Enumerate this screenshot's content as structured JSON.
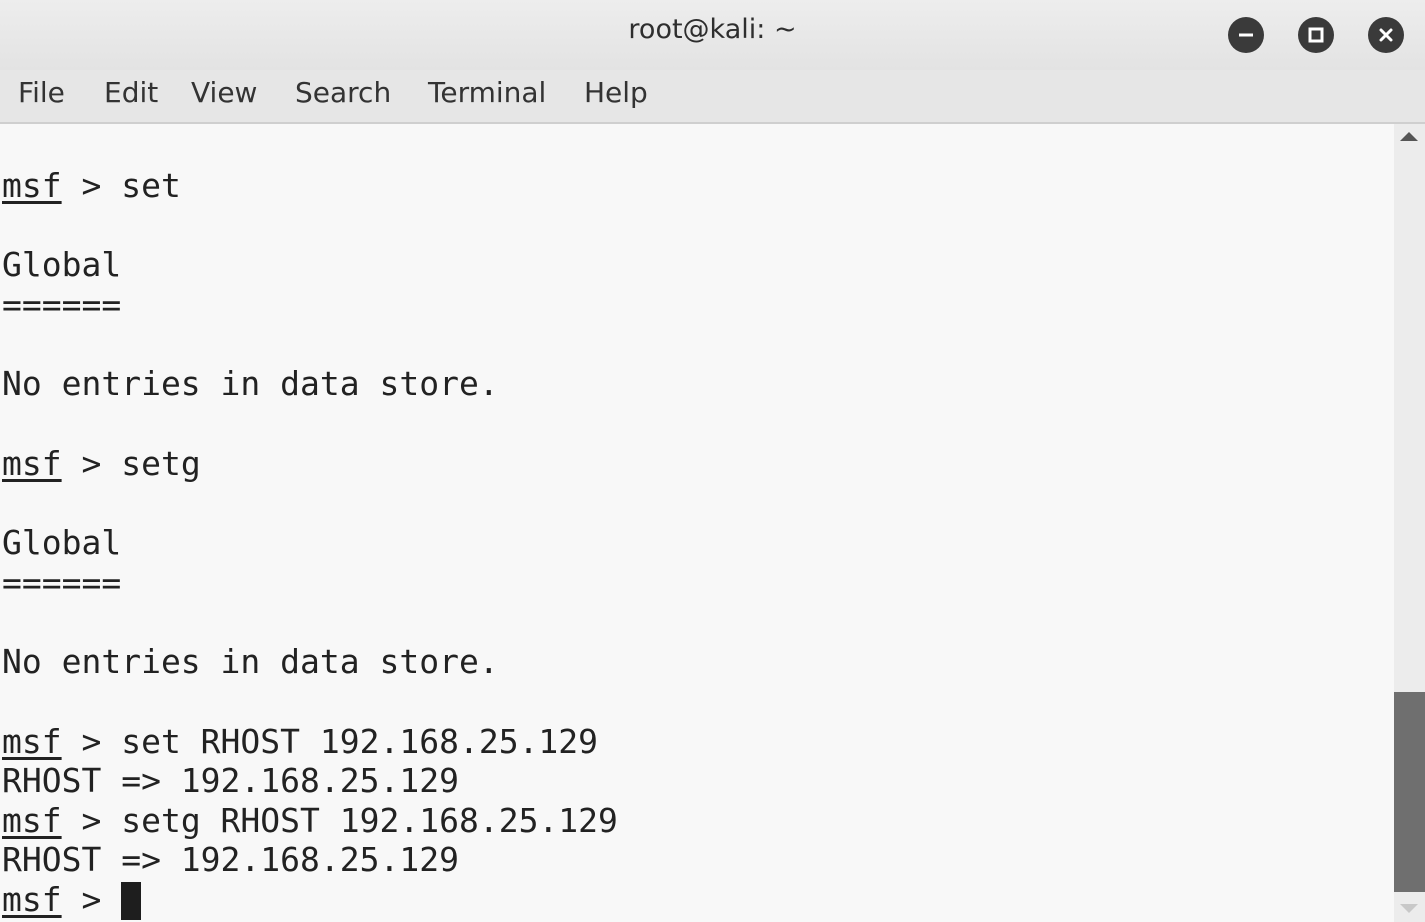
{
  "window": {
    "title": "root@kali: ~"
  },
  "menu": {
    "items": [
      "File",
      "Edit",
      "View",
      "Search",
      "Terminal",
      "Help"
    ]
  },
  "terminal": {
    "prompt": "msf",
    "lines": [
      {
        "prompt": "msf",
        "text": " > set"
      },
      {
        "text": "Global"
      },
      {
        "text": "======"
      },
      {
        "text": "No entries in data store."
      },
      {
        "prompt": "msf",
        "text": " > setg"
      },
      {
        "text": "Global"
      },
      {
        "text": "======"
      },
      {
        "text": "No entries in data store."
      },
      {
        "prompt": "msf",
        "text": " > set RHOST 192.168.25.129"
      },
      {
        "text": "RHOST => 192.168.25.129"
      },
      {
        "prompt": "msf",
        "text": " > setg RHOST 192.168.25.129"
      },
      {
        "text": "RHOST => 192.168.25.129"
      },
      {
        "prompt": "msf",
        "text": " > "
      }
    ]
  },
  "scrollbar": {
    "position_fraction": 0.86
  },
  "icons": {
    "minimize": "minimize-icon",
    "maximize": "maximize-icon",
    "close": "close-icon"
  },
  "colors": {
    "background": "#f8f8f8",
    "text": "#222222",
    "titlebar": "#e9e9e9",
    "window_button": "#3a3a3a"
  }
}
